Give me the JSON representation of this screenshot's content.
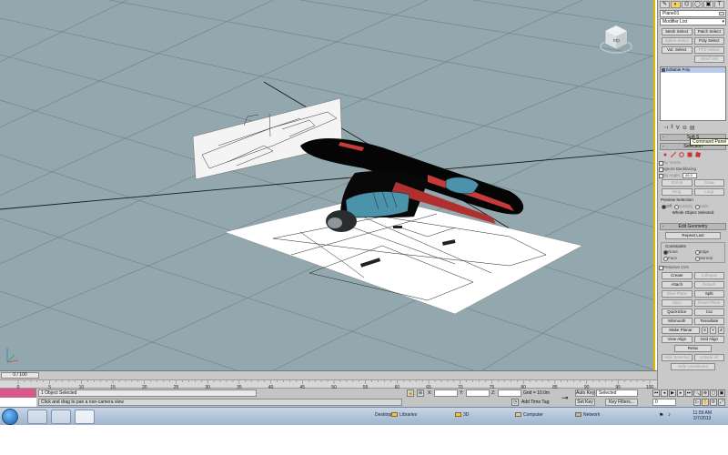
{
  "command_panel": {
    "object_name": "Plane01",
    "modifier_list": "Modifier List",
    "select_buttons": [
      "Mesh Select",
      "Patch Select",
      "Spline Select",
      "Poly Select",
      "Vol. Select",
      "FFD Select",
      "",
      "NSurf Sel"
    ],
    "stack_item": "Editable Poly",
    "rollouts": {
      "soft_sel": "Soft S",
      "selection": "Selection",
      "edit_geometry": "Edit Geometry"
    },
    "selection": {
      "by_vertex": "By Vertex",
      "ignore_backfacing": "Ignore Backfacing",
      "by_angle": "By Angle:",
      "by_angle_value": "45.0",
      "shrink": "Shrink",
      "grow": "Grow",
      "ring": "Ring",
      "loop": "Loop",
      "preview_selection": "Preview Selection",
      "preview_off": "Off",
      "preview_subobj": "SubObj",
      "preview_multi": "Multi",
      "whole_object_selected": "Whole Object Selected"
    },
    "edit_geometry": {
      "repeat_last": "Repeat Last",
      "constraints": "Constraints",
      "none": "None",
      "edge": "Edge",
      "face": "Face",
      "normal": "Normal",
      "preserve_uvs": "Preserve UVs",
      "create": "Create",
      "collapse": "Collapse",
      "attach": "Attach",
      "detach": "Detach",
      "slice_plane": "Slice Plane",
      "split": "Split",
      "slice": "Slice",
      "reset_plane": "Reset Plane",
      "quickslice": "QuickSlice",
      "cut": "Cut",
      "msmooth": "MSmooth",
      "tessellate": "Tessellate",
      "make_planar": "Make Planar",
      "x": "X",
      "y": "Y",
      "z": "Z",
      "view_align": "View Align",
      "grid_align": "Grid Align",
      "relax": "Relax",
      "hide_selected": "Hide Selected",
      "unhide_all": "Unhide All",
      "hide_unselected": "Hide Unselected"
    },
    "tooltip": "Command Panel"
  },
  "timeline": {
    "slider_label": "0 / 100",
    "ticks": [
      "0",
      "5",
      "10",
      "15",
      "20",
      "25",
      "30",
      "35",
      "40",
      "45",
      "50",
      "55",
      "60",
      "65",
      "70",
      "75",
      "80",
      "85",
      "90",
      "95",
      "100"
    ]
  },
  "status": {
    "selection_status": "1 Object Selected",
    "prompt": "Click and drag to pan a non-camera view",
    "x_label": "X:",
    "y_label": "Y:",
    "z_label": "Z:",
    "grid": "Grid = 10.0m",
    "add_time_tag": "Add Time Tag",
    "auto_key": "Auto Key",
    "selected": "Selected",
    "set_key": "Set Key",
    "key_filters": "Key Filters...",
    "frame": "0"
  },
  "taskbar": {
    "links": [
      "Desktop",
      "Libraries",
      "3D",
      "Computer",
      "Network"
    ],
    "time": "11:59 AM",
    "date": "2/7/2013"
  },
  "colors": {
    "viewport_bg": "#93a8ae",
    "active_border": "#e2b700",
    "panel_bg": "#c9c9c9"
  }
}
